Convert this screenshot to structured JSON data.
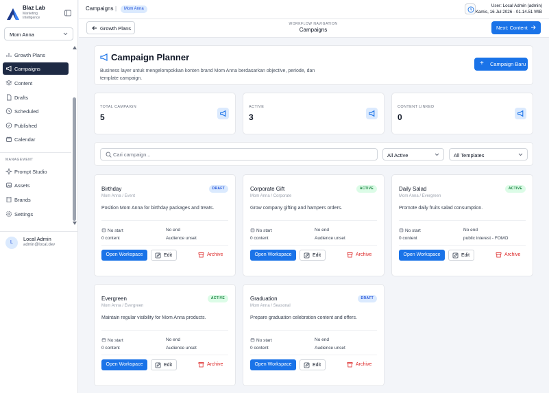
{
  "sidebar": {
    "brand_name": "Blaz Lab",
    "brand_subtitle": "Marketing Intelligence",
    "brand_select": "Mom Anna",
    "items": [
      {
        "label": "Growth Plans",
        "icon": "chart-icon"
      },
      {
        "label": "Campaigns",
        "icon": "megaphone-icon",
        "active": true
      },
      {
        "label": "Content",
        "icon": "layers-icon"
      },
      {
        "label": "Drafts",
        "icon": "file-icon"
      },
      {
        "label": "Scheduled",
        "icon": "clock-icon"
      },
      {
        "label": "Published",
        "icon": "check-circle-icon"
      },
      {
        "label": "Calendar",
        "icon": "calendar-icon"
      }
    ],
    "management_label": "MANAGEMENT",
    "management_items": [
      {
        "label": "Prompt Studio",
        "icon": "sparkles-icon"
      },
      {
        "label": "Assets",
        "icon": "image-icon"
      },
      {
        "label": "Brands",
        "icon": "building-icon"
      },
      {
        "label": "Settings",
        "icon": "gear-icon"
      }
    ],
    "user": {
      "initial": "L",
      "name": "Local Admin",
      "email": "admin@local.dev"
    }
  },
  "topbar": {
    "breadcrumb": "Campaigns",
    "breadcrumb_sep": "|",
    "brand_pill": "Mom Anna",
    "user_line": "User: Local Admin (admin)",
    "datetime": "Kamis, 16 Jul 2026 · 01.14.51 WIB"
  },
  "workflow": {
    "back_label": "Growth Plans",
    "nav_label": "WORKFLOW NAVIGATION",
    "current": "Campaigns",
    "next_label": "Next: Content"
  },
  "planner": {
    "title": "Campaign Planner",
    "description": "Business layer untuk mengelompokkan konten brand Mom Anna berdasarkan objective, periode, dan template campaign.",
    "new_button": "Campaign Baru"
  },
  "stats": [
    {
      "label": "TOTAL CAMPAIGN",
      "value": "5"
    },
    {
      "label": "ACTIVE",
      "value": "3"
    },
    {
      "label": "CONTENT LINKED",
      "value": "0"
    }
  ],
  "filters": {
    "search_placeholder": "Cari campaign...",
    "status": "All Active",
    "template": "All Templates"
  },
  "actions": {
    "open": "Open Workspace",
    "edit": "Edit",
    "archive": "Archive"
  },
  "campaigns": [
    {
      "title": "Birthday",
      "badge": "DRAFT",
      "subtitle": "Mom Anna / Event",
      "desc": "Position Mom Anna for birthday packages and treats.",
      "start": "No start",
      "end": "No end",
      "content": "0 content",
      "audience": "Audience unset"
    },
    {
      "title": "Corporate Gift",
      "badge": "ACTIVE",
      "subtitle": "Mom Anna / Corporate",
      "desc": "Grow company gifting and hampers orders.",
      "start": "No start",
      "end": "No end",
      "content": "0 content",
      "audience": "Audience unset"
    },
    {
      "title": "Daily Salad",
      "badge": "ACTIVE",
      "subtitle": "Mom Anna / Evergreen",
      "desc": "Promote daily fruits salad consumption.",
      "start": "No start",
      "end": "No end",
      "content": "0 content",
      "audience": "public interest - FOMO"
    },
    {
      "title": "Evergreen",
      "badge": "ACTIVE",
      "subtitle": "Mom Anna / Evergreen",
      "desc": "Maintain regular visibility for Mom Anna products.",
      "start": "No start",
      "end": "No end",
      "content": "0 content",
      "audience": "Audience unset"
    },
    {
      "title": "Graduation",
      "badge": "DRAFT",
      "subtitle": "Mom Anna / Seasonal",
      "desc": "Prepare graduation celebration content and offers.",
      "start": "No start",
      "end": "No end",
      "content": "0 content",
      "audience": "Audience unset"
    }
  ],
  "colors": {
    "primary": "#1a73e8",
    "sidebar_active": "#1e2a44",
    "active_badge": "#15803d",
    "draft_badge": "#1d4ed8",
    "danger": "#dc2626"
  }
}
